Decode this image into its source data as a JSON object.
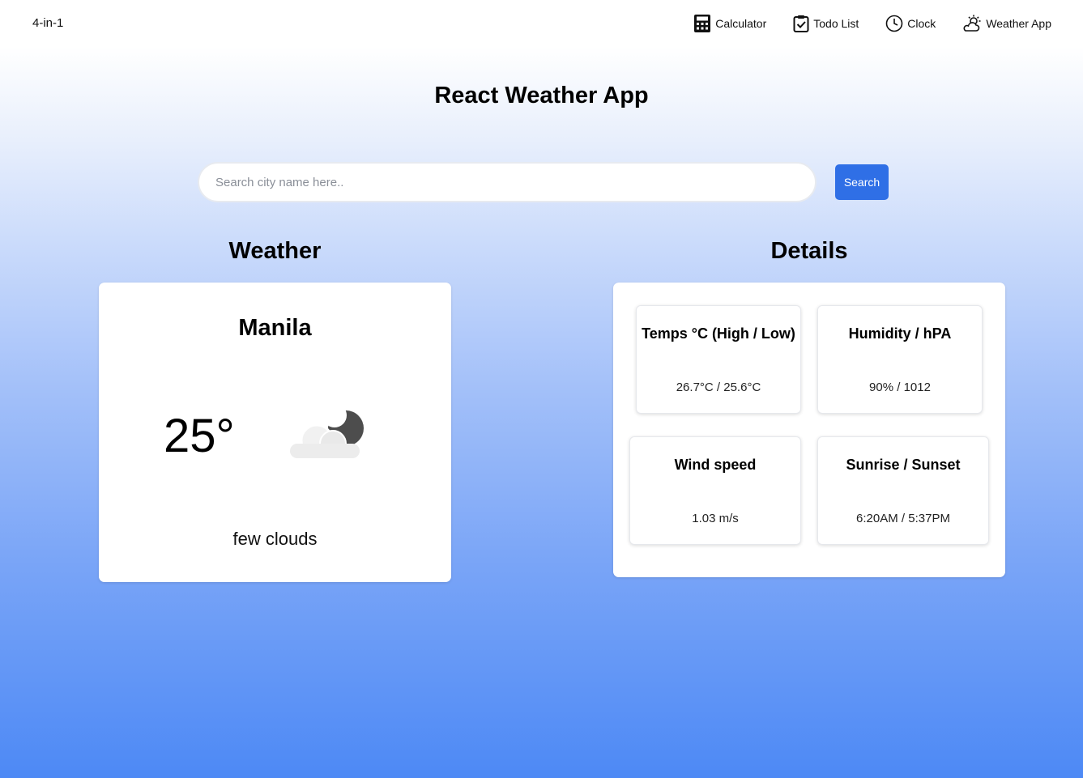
{
  "brand": "4-in-1",
  "nav": [
    {
      "label": "Calculator",
      "icon": "calculator-icon"
    },
    {
      "label": "Todo List",
      "icon": "clipboard-check-icon"
    },
    {
      "label": "Clock",
      "icon": "clock-icon"
    },
    {
      "label": "Weather App",
      "icon": "sun-cloud-icon"
    }
  ],
  "app_title": "React Weather App",
  "search": {
    "placeholder": "Search city name here..",
    "value": "",
    "button_label": "Search"
  },
  "weather": {
    "section_title": "Weather",
    "city": "Manila",
    "temperature": "25°",
    "icon": "few-clouds-night-icon",
    "description": "few clouds"
  },
  "details": {
    "section_title": "Details",
    "items": [
      {
        "label": "Temps °C (High / Low)",
        "value": "26.7°C / 25.6°C"
      },
      {
        "label": "Humidity / hPA",
        "value": "90% / 1012"
      },
      {
        "label": "Wind speed",
        "value": "1.03 m/s"
      },
      {
        "label": "Sunrise / Sunset",
        "value": "6:20AM / 5:37PM"
      }
    ]
  },
  "colors": {
    "accent": "#2f6fe6",
    "gradient_bottom": "#4d89f5"
  }
}
